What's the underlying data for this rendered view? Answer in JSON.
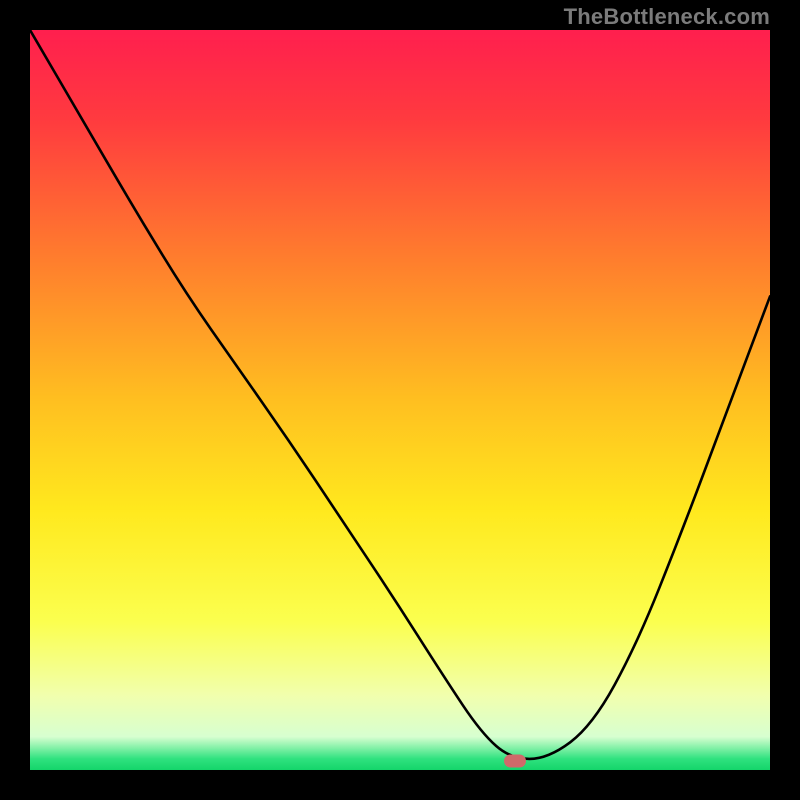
{
  "watermark": "TheBottleneck.com",
  "marker": {
    "color": "#cf6a6a",
    "x_frac": 0.655,
    "y_frac": 0.988
  },
  "gradient_stops": [
    {
      "offset": 0.0,
      "color": "#ff1f4e"
    },
    {
      "offset": 0.12,
      "color": "#ff3a3f"
    },
    {
      "offset": 0.3,
      "color": "#ff7a2e"
    },
    {
      "offset": 0.5,
      "color": "#ffbf20"
    },
    {
      "offset": 0.65,
      "color": "#ffe91e"
    },
    {
      "offset": 0.8,
      "color": "#fbff4f"
    },
    {
      "offset": 0.9,
      "color": "#f1ffae"
    },
    {
      "offset": 0.955,
      "color": "#d7ffd0"
    },
    {
      "offset": 0.985,
      "color": "#2fe27f"
    },
    {
      "offset": 1.0,
      "color": "#14d56a"
    }
  ],
  "chart_data": {
    "type": "line",
    "title": "",
    "xlabel": "",
    "ylabel": "",
    "xlim": [
      0,
      1
    ],
    "ylim": [
      0,
      1
    ],
    "series": [
      {
        "name": "bottleneck-curve",
        "x": [
          0.0,
          0.07,
          0.14,
          0.21,
          0.28,
          0.35,
          0.42,
          0.49,
          0.56,
          0.61,
          0.65,
          0.7,
          0.76,
          0.82,
          0.88,
          0.94,
          1.0
        ],
        "y": [
          1.0,
          0.88,
          0.76,
          0.645,
          0.545,
          0.445,
          0.34,
          0.235,
          0.125,
          0.05,
          0.015,
          0.015,
          0.06,
          0.17,
          0.32,
          0.48,
          0.64
        ]
      }
    ],
    "marker": {
      "x": 0.655,
      "y": 0.012
    }
  }
}
